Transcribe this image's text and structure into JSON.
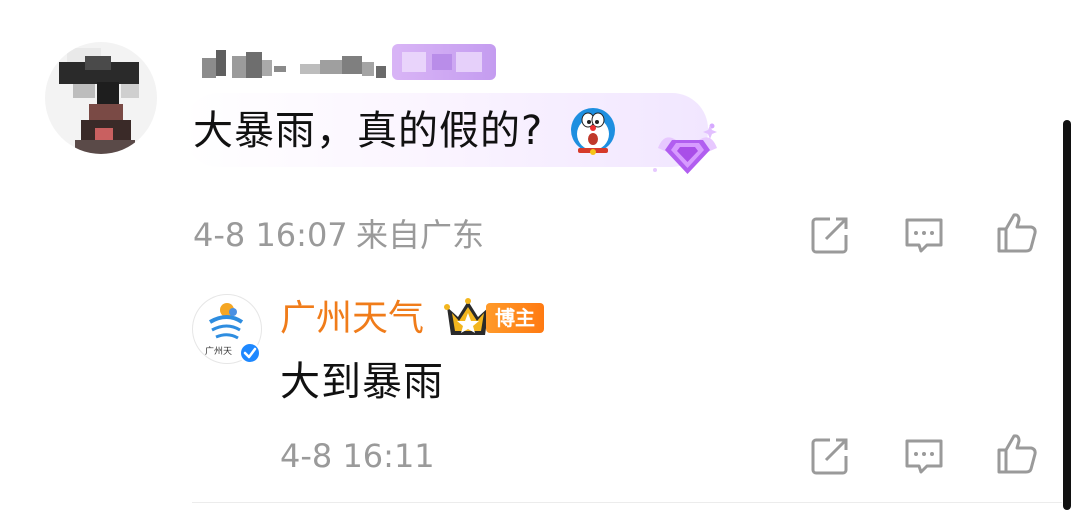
{
  "comment": {
    "text": "大暴雨，真的假的?",
    "time": "4-8 16:07",
    "location": "来自广东"
  },
  "reply": {
    "author": "广州天气",
    "author_badge": "博主",
    "avatar_caption": "广州天",
    "text": "大到暴雨",
    "time": "4-8 16:11"
  },
  "icons": [
    "share-icon",
    "comment-icon",
    "like-icon"
  ],
  "colors": {
    "author_name": "#f07c1a",
    "badge_bg": "#ff8a1e",
    "meta_text": "#9a9a9a",
    "verified": "#1e88ff",
    "level_badge": "#c9a6f3"
  }
}
